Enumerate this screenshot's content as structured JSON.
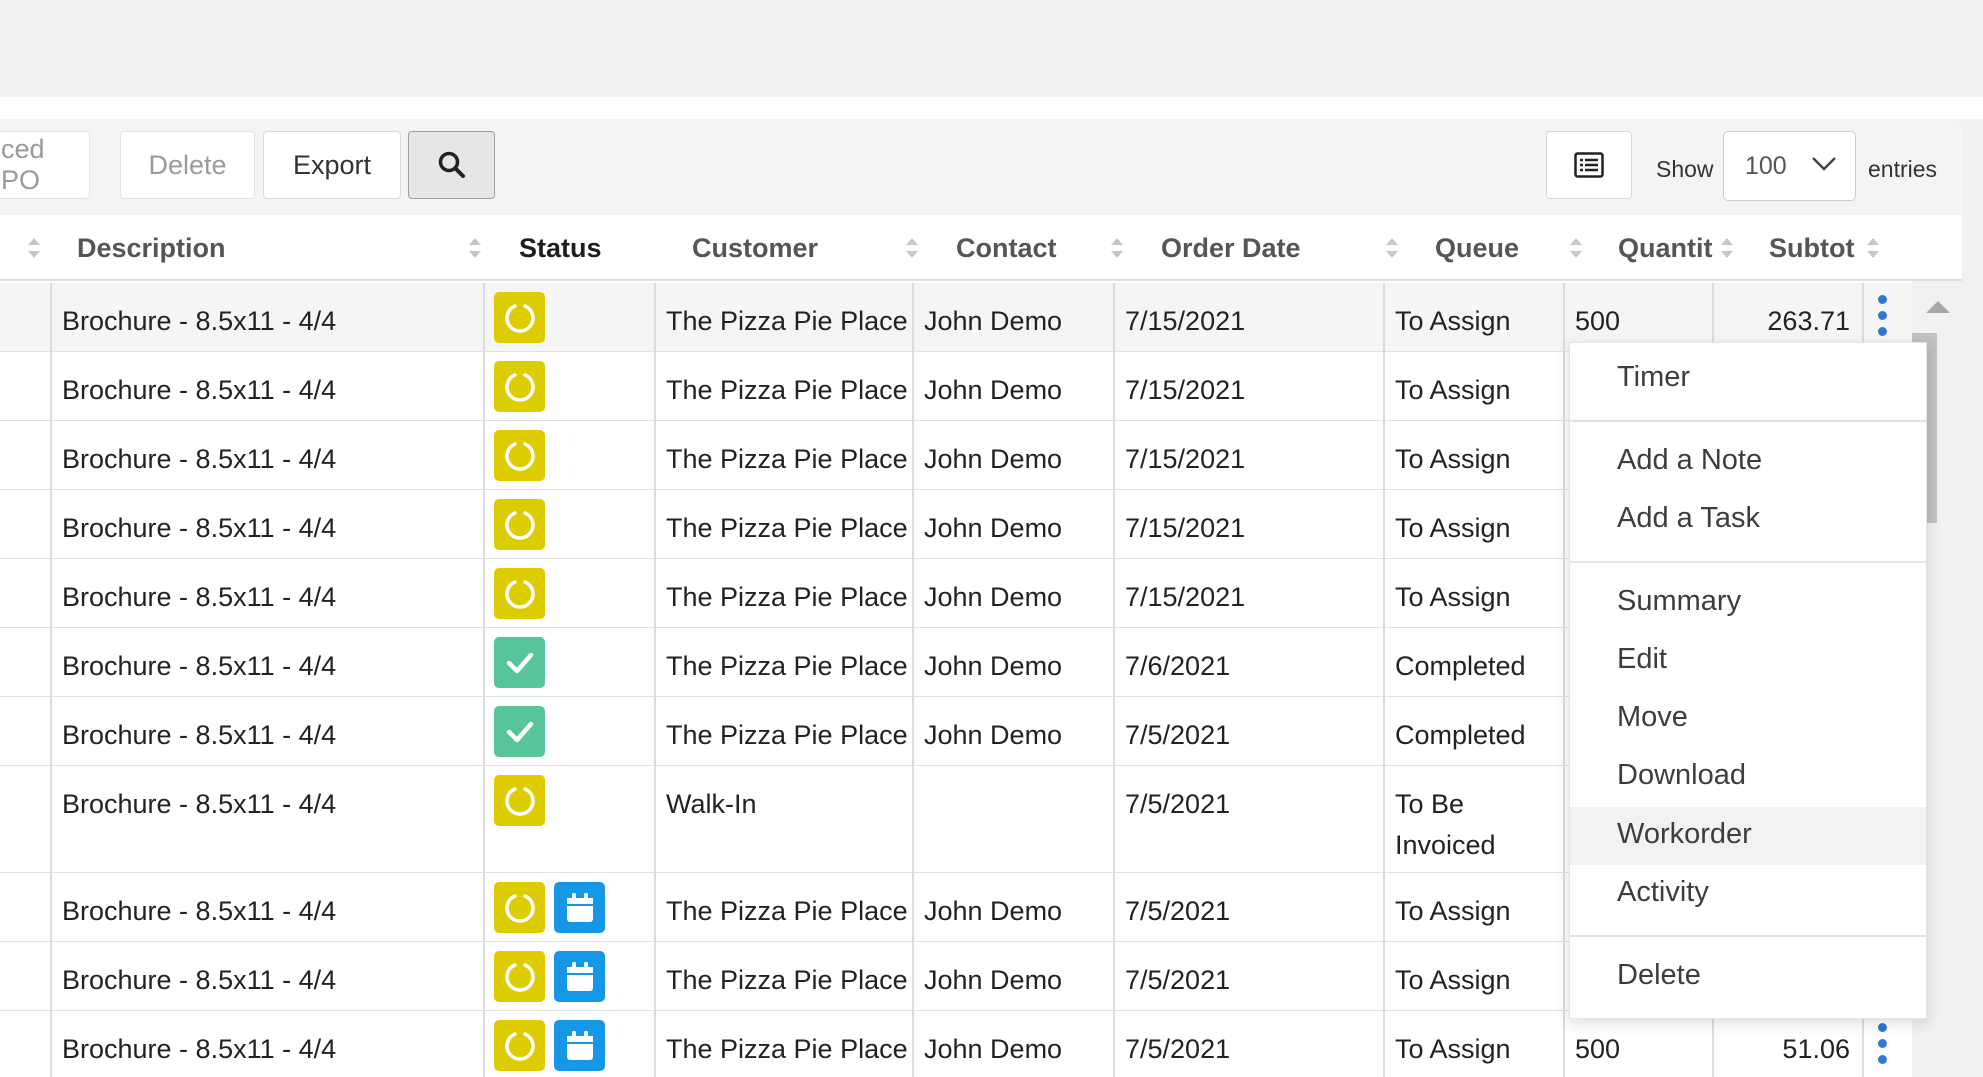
{
  "toolbar": {
    "linked_po_label": "ced PO",
    "delete_label": "Delete",
    "export_label": "Export",
    "show_label": "Show",
    "entries_value": "100",
    "entries_label": "entries"
  },
  "columns": [
    "Description",
    "Status",
    "Customer",
    "Contact",
    "Order Date",
    "Queue",
    "Quantit",
    "Subtot"
  ],
  "rows": [
    {
      "description": "Brochure - 8.5x11 - 4/4",
      "status": [
        "in-progress"
      ],
      "customer": "The Pizza Pie Place",
      "contact": "John Demo",
      "order_date": "7/15/2021",
      "queue": "To Assign",
      "quantity": "500",
      "subtotal": "263.71"
    },
    {
      "description": "Brochure - 8.5x11 - 4/4",
      "status": [
        "in-progress"
      ],
      "customer": "The Pizza Pie Place",
      "contact": "John Demo",
      "order_date": "7/15/2021",
      "queue": "To Assign"
    },
    {
      "description": "Brochure - 8.5x11 - 4/4",
      "status": [
        "in-progress"
      ],
      "customer": "The Pizza Pie Place",
      "contact": "John Demo",
      "order_date": "7/15/2021",
      "queue": "To Assign"
    },
    {
      "description": "Brochure - 8.5x11 - 4/4",
      "status": [
        "in-progress"
      ],
      "customer": "The Pizza Pie Place",
      "contact": "John Demo",
      "order_date": "7/15/2021",
      "queue": "To Assign"
    },
    {
      "description": "Brochure - 8.5x11 - 4/4",
      "status": [
        "in-progress"
      ],
      "customer": "The Pizza Pie Place",
      "contact": "John Demo",
      "order_date": "7/15/2021",
      "queue": "To Assign"
    },
    {
      "description": "Brochure - 8.5x11 - 4/4",
      "status": [
        "completed"
      ],
      "customer": "The Pizza Pie Place",
      "contact": "John Demo",
      "order_date": "7/6/2021",
      "queue": "Completed"
    },
    {
      "description": "Brochure - 8.5x11 - 4/4",
      "status": [
        "completed"
      ],
      "customer": "The Pizza Pie Place",
      "contact": "John Demo",
      "order_date": "7/5/2021",
      "queue": "Completed"
    },
    {
      "description": "Brochure - 8.5x11 - 4/4",
      "status": [
        "in-progress"
      ],
      "customer": "Walk-In",
      "contact": "",
      "order_date": "7/5/2021",
      "queue_lines": [
        "To Be",
        "Invoiced"
      ]
    },
    {
      "description": "Brochure - 8.5x11 - 4/4",
      "status": [
        "in-progress",
        "scheduled"
      ],
      "customer": "The Pizza Pie Place",
      "contact": "John Demo",
      "order_date": "7/5/2021",
      "queue": "To Assign"
    },
    {
      "description": "Brochure - 8.5x11 - 4/4",
      "status": [
        "in-progress",
        "scheduled"
      ],
      "customer": "The Pizza Pie Place",
      "contact": "John Demo",
      "order_date": "7/5/2021",
      "queue": "To Assign"
    },
    {
      "description": "Brochure - 8.5x11 - 4/4",
      "status": [
        "in-progress",
        "scheduled"
      ],
      "customer": "The Pizza Pie Place",
      "contact": "John Demo",
      "order_date": "7/5/2021",
      "queue": "To Assign",
      "quantity": "500",
      "subtotal": "51.06"
    }
  ],
  "context_menu": {
    "timer": "Timer",
    "add_note": "Add a Note",
    "add_task": "Add a Task",
    "summary": "Summary",
    "edit": "Edit",
    "move": "Move",
    "download": "Download",
    "workorder": "Workorder",
    "activity": "Activity",
    "delete": "Delete",
    "highlighted": "Workorder"
  },
  "colors": {
    "status_in_progress": "#dccc00",
    "status_completed": "#58c49a",
    "status_scheduled": "#1597e5",
    "kebab": "#2e78d0"
  },
  "icons": {
    "search": "search-icon",
    "column_view": "list-view-icon",
    "dropdown": "chevron-down-icon",
    "in_progress": "circle-progress-icon",
    "completed": "check-icon",
    "scheduled": "calendar-icon",
    "row_actions": "kebab-menu-icon"
  }
}
